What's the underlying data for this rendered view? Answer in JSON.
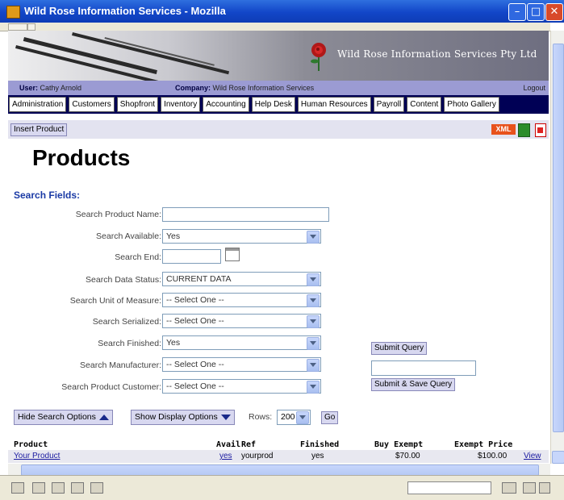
{
  "window": {
    "title": "Wild Rose Information Services - Mozilla"
  },
  "banner": {
    "company_name": "Wild Rose Information Services Pty Ltd"
  },
  "userbar": {
    "user_label": "User:",
    "user_value": "Cathy Arnold",
    "company_label": "Company:",
    "company_value": "Wild Rose Information Services",
    "logout": "Logout"
  },
  "nav": [
    "Administration",
    "Customers",
    "Shopfront",
    "Inventory",
    "Accounting",
    "Help Desk",
    "Human Resources",
    "Payroll",
    "Content",
    "Photo Gallery"
  ],
  "actions": {
    "insert_product": "Insert Product",
    "xml": "XML"
  },
  "page": {
    "title": "Products",
    "search_heading": "Search Fields:"
  },
  "fields": [
    {
      "label": "Search Product Name:",
      "value": ""
    },
    {
      "label": "Search Available:",
      "value": "Yes"
    },
    {
      "label": "Search End:",
      "value": ""
    },
    {
      "label": "Search Data Status:",
      "value": "CURRENT DATA"
    },
    {
      "label": "Search Unit of Measure:",
      "value": "-- Select One --"
    },
    {
      "label": "Search Serialized:",
      "value": "-- Select One --"
    },
    {
      "label": "Search Finished:",
      "value": "Yes"
    },
    {
      "label": "Search Manufacturer:",
      "value": "-- Select One --"
    },
    {
      "label": "Search Product Customer:",
      "value": "-- Select One --"
    }
  ],
  "query": {
    "submit": "Submit Query",
    "submit_save": "Submit & Save Query"
  },
  "options": {
    "hide_search": "Hide Search Options",
    "show_display": "Show Display Options",
    "rows_label": "Rows:",
    "rows_value": "200",
    "go": "Go"
  },
  "table": {
    "headers": [
      "Product",
      "Avail",
      "Ref",
      "Finished",
      "Buy Exempt",
      "Exempt Price"
    ],
    "rows": [
      {
        "product": "Your Product",
        "avail": "yes",
        "ref": "yourprod",
        "finished": "yes",
        "buy_exempt": "$70.00",
        "exempt_price": "$100.00",
        "action": "View"
      }
    ]
  },
  "colors": {
    "titlebar": "#1246c8",
    "nav_bg": "#000055",
    "userbar": "#9b9bd3",
    "heading": "#1a3aa5"
  }
}
